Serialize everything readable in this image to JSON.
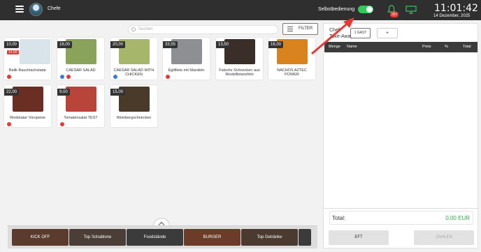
{
  "header": {
    "user": "Chefe",
    "selbstbedienung_label": "Selbstbedienung",
    "selbstbedienung_on": true,
    "notifications_count": "267",
    "time": "11:01:42",
    "date": "14 Dezember, 2025"
  },
  "search": {
    "placeholder": "Suchen"
  },
  "filter": {
    "label": "FILTER"
  },
  "products": [
    {
      "name": "Balik Rauchlachstatar",
      "price": "10,00",
      "old_price": "14,50",
      "icons": [
        "red"
      ],
      "img": "#d9e4ea"
    },
    {
      "name": "CAESAR SALAD",
      "price": "16,00",
      "old_price": "",
      "icons": [
        "blue",
        "red"
      ],
      "img": "#8aa35a"
    },
    {
      "name": "CAESAR SALAD WITH CHICKEN",
      "price": "20,00",
      "old_price": "",
      "icons": [
        "blue"
      ],
      "img": "#a6b66a"
    },
    {
      "name": "Eglifilets mit Mandeln",
      "price": "33,55",
      "old_price": "",
      "icons": [
        "red"
      ],
      "img": "#8d8f92"
    },
    {
      "name": "Falsche Schnecken aus Rindsfiletwürfeln",
      "price": "13,50",
      "old_price": "",
      "icons": [],
      "img": "#3a2e28"
    },
    {
      "name": "NACHOS AZTEC POWER",
      "price": "16,00",
      "old_price": "",
      "icons": [],
      "img": "#d9831e"
    },
    {
      "name": "Rindstatar Vorspeise",
      "price": "22,00",
      "old_price": "",
      "icons": [
        "red"
      ],
      "img": "#6b2e22"
    },
    {
      "name": "Tomatensalat TEST",
      "price": "9,00",
      "old_price": "",
      "icons": [
        "red"
      ],
      "img": "#b8443a"
    },
    {
      "name": "Weinbergschnecken",
      "price": "15,00",
      "old_price": "",
      "icons": [],
      "img": "#4a3a2a"
    }
  ],
  "categories": [
    "KICK OFF",
    "Top Schablone",
    "Foodstände",
    "BURGER",
    "Top Getränke"
  ],
  "cart": {
    "title_line1": "Chef",
    "title_line2": "Take-Away",
    "gast_label": "1 GAST",
    "plus_label": "+",
    "columns": [
      "Menge",
      "Name",
      "Preis",
      "%",
      "Total"
    ],
    "total_label": "Total:",
    "total_value": "0,00 EUR",
    "eft_label": "EFT",
    "pay_label": "ZAHLEN"
  },
  "colors": {
    "accent_green": "#35c759",
    "header_bg": "#2f2f2f",
    "arrow": "#e53935"
  }
}
